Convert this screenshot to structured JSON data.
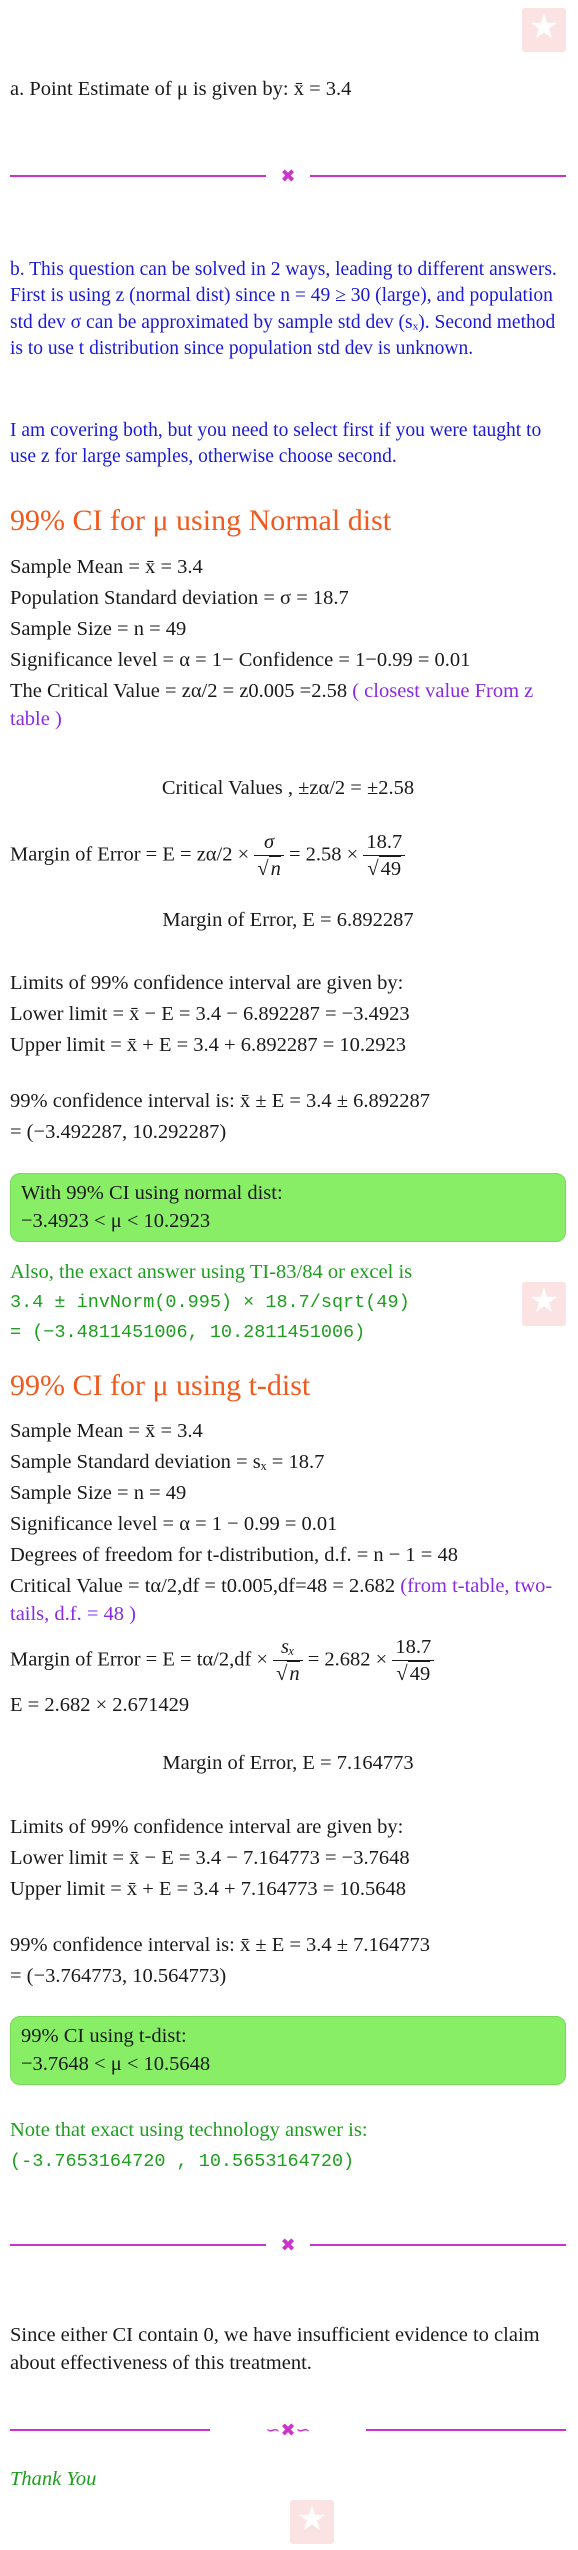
{
  "part_a": {
    "text": "a. Point Estimate of μ is given by: x̄ = 3.4"
  },
  "divider_1_glyph": "✖",
  "part_b": {
    "intro": "b. This question can be solved in 2 ways, leading to different answers. First is using z (normal dist) since n = 49 ≥ 30 (large), and population std dev σ can be approximated by sample std dev (sₓ). Second method is to use t distribution since population std dev is unknown.",
    "note": "I am covering both, but you need to select first if you were taught to use z for large samples, otherwise choose second."
  },
  "normal": {
    "heading": "99% CI for μ using Normal dist",
    "sample_mean": "Sample Mean = x̄ = 3.4",
    "pop_sd": "Population Standard deviation = σ = 18.7",
    "sample_size": "Sample Size = n = 49",
    "signif": "Significance level = α = 1− Confidence = 1−0.99 = 0.01",
    "critical_main": "The Critical Value = zα/2 = z0.005 =2.58",
    "critical_note": " ( closest value From z table )",
    "critical_values": "Critical Values , ±zα/2 = ±2.58",
    "moe_lhs": "Margin of Error = E = zα/2 ×",
    "moe_frac1_num": "σ",
    "moe_frac1_den": "n",
    "moe_mid": "= 2.58 ×",
    "moe_frac2_num": "18.7",
    "moe_frac2_den": "49",
    "moe_value": "Margin of Error, E = 6.892287",
    "limits_title": "Limits of 99% confidence interval are given by:",
    "lower": "Lower limit = x̄ − E = 3.4 − 6.892287 = −3.4923",
    "upper": "Upper limit = x̄ + E = 3.4 + 6.892287 = 10.2923",
    "ci_line1": "99% confidence interval is: x̄ ± E = 3.4 ± 6.892287",
    "ci_line2": "= (−3.492287, 10.292287)",
    "box_line1": "With 99% CI using normal dist:",
    "box_line2": "−3.4923 < μ < 10.2923",
    "exact_line1": "Also, the exact answer using TI-83/84 or excel is",
    "exact_line2": "3.4 ± invNorm(0.995) × 18.7/sqrt(49)",
    "exact_line3": "= (−3.4811451006, 10.2811451006)"
  },
  "tdist": {
    "heading": "99% CI for μ using t-dist",
    "sample_mean": "Sample Mean = x̄ = 3.4",
    "sample_sd": "Sample Standard deviation = sₓ = 18.7",
    "sample_size": "Sample Size = n = 49",
    "signif": "Significance level = α = 1 − 0.99 = 0.01",
    "df": "Degrees of freedom for t-distribution, d.f. = n − 1 = 48",
    "critical_main": "Critical Value = tα/2,df = t0.005,df=48 = 2.682",
    "critical_note": " (from t-table, two-tails, d.f. = 48 )",
    "moe_lhs": "Margin of Error = E = tα/2,df ×",
    "moe_frac1_num": "sₓ",
    "moe_frac1_den": "n",
    "moe_mid": "= 2.682 ×",
    "moe_frac2_num": "18.7",
    "moe_frac2_den": "49",
    "moe_product": "E = 2.682 × 2.671429",
    "moe_value": "Margin of Error, E = 7.164773",
    "limits_title": "Limits of 99% confidence interval are given by:",
    "lower": "Lower limit = x̄ − E = 3.4 − 7.164773 = −3.7648",
    "upper": "Upper limit = x̄ + E = 3.4 + 7.164773 = 10.5648",
    "ci_line1": "99% confidence interval is: x̄ ± E = 3.4 ± 7.164773",
    "ci_line2": "= (−3.764773, 10.564773)",
    "box_line1": "99% CI using t-dist:",
    "box_line2": "−3.7648 < μ < 10.5648",
    "exact_line1": "Note that exact using technology answer is:",
    "exact_line2": "(-3.7653164720 , 10.5653164720)"
  },
  "divider_2_glyph": "✖",
  "conclusion": "Since either CI contain 0, we have insufficient evidence to claim about effectiveness of this treatment.",
  "divider_3_glyph": "∽✖∽",
  "thank_you": "Thank You",
  "colors": {
    "heading": "#f05a1e",
    "intro_blue": "#1a1ad6",
    "note_purple": "#8a2be2",
    "green_text": "#1e9e1e",
    "result_box": "#88ee66",
    "divider": "#cc33cc"
  }
}
